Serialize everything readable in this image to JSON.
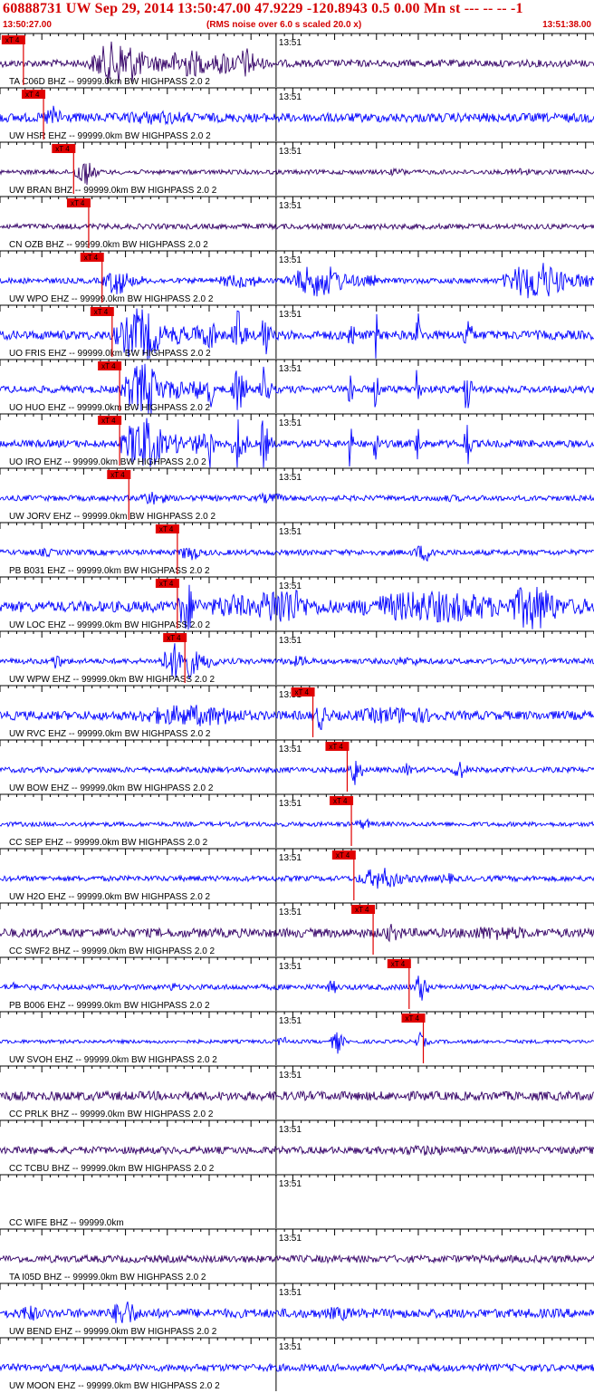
{
  "header": {
    "title": "60888731 UW Sep 29, 2014 13:50:47.00   47.9229 -120.8943  0.5 0.00 Mn st --- -- --  -1",
    "start_time": "13:50:27.00",
    "noise_note": "(RMS noise over 6.0 s scaled 20.0 x)",
    "end_time": "13:51:38.00"
  },
  "chart_data": {
    "type": "seismogram",
    "time_range": [
      "13:50:27.00",
      "13:51:38.00"
    ],
    "minute_label": "13:51",
    "pick_label": "xT 4",
    "colors": {
      "header": "#d40000",
      "pick": "#e00000",
      "trace_blue": "#0000ff",
      "trace_dark": "#330066",
      "grid": "#000000"
    },
    "traces": [
      {
        "label": "TA C06D BHZ -- 99999.0km BW  HIGHPASS  2.0  2",
        "color": "#330066",
        "pick_s": 2.8,
        "amp": 4,
        "bursts": [
          [
            10.5,
            20.5,
            26
          ],
          [
            25,
            30,
            14
          ],
          [
            28,
            32,
            18
          ],
          [
            19,
            28,
            16
          ]
        ]
      },
      {
        "label": "UW HSR EHZ -- 99999.0km BW  HIGHPASS  2.0  2",
        "color": "#0000ff",
        "pick_s": 5.2,
        "amp": 5,
        "bursts": [
          [
            5,
            9,
            14
          ],
          [
            12,
            30,
            8
          ],
          [
            25,
            60,
            5
          ]
        ]
      },
      {
        "label": "UW BRAN BHZ -- 99999.0km BW  HIGHPASS  2.0  2",
        "color": "#330066",
        "pick_s": 8.8,
        "amp": 2.5,
        "bursts": [
          [
            8.8,
            12,
            16
          ],
          [
            45,
            52,
            4
          ],
          [
            60,
            66,
            5
          ]
        ]
      },
      {
        "label": "CN OZB BHZ -- 99999.0km BW  HIGHPASS  2.0  2",
        "color": "#330066",
        "pick_s": 10.6,
        "amp": 3,
        "bursts": []
      },
      {
        "label": "UW WPO EHZ -- 99999.0km BW  HIGHPASS  2.0  2",
        "color": "#0000ff",
        "pick_s": 12.2,
        "amp": 3,
        "bursts": [
          [
            12.2,
            17,
            16
          ],
          [
            25,
            35,
            8
          ],
          [
            34,
            45,
            18
          ],
          [
            60,
            71,
            22
          ]
        ]
      },
      {
        "label": "UO FRIS EHZ -- 99999.0km BW  HIGHPASS  2.0  2",
        "color": "#0000ff",
        "pick_s": 13.4,
        "amp": 5,
        "bursts": [
          [
            13.6,
            22,
            30
          ],
          [
            22,
            28,
            12
          ],
          [
            24.8,
            26,
            30
          ],
          [
            27.7,
            29.6,
            30
          ],
          [
            31,
            32.5,
            30
          ],
          [
            41.6,
            42.4,
            30
          ],
          [
            44.6,
            45.4,
            30
          ],
          [
            49.6,
            50.4,
            30
          ],
          [
            55.4,
            56.6,
            30
          ]
        ]
      },
      {
        "label": "UO HUO EHZ -- 99999.0km BW  HIGHPASS  2.0  2",
        "color": "#0000ff",
        "pick_s": 14.3,
        "amp": 4,
        "bursts": [
          [
            14.3,
            22,
            30
          ],
          [
            22,
            27,
            12
          ],
          [
            24.8,
            25.6,
            30
          ],
          [
            27.7,
            29.6,
            30
          ],
          [
            31,
            32.5,
            30
          ],
          [
            41.6,
            42.4,
            30
          ],
          [
            44.6,
            45.4,
            30
          ],
          [
            49.6,
            50.4,
            30
          ],
          [
            55.4,
            56.6,
            30
          ]
        ]
      },
      {
        "label": "UO IRO EHZ -- 99999.0km BW  HIGHPASS  2.0  2",
        "color": "#0000ff",
        "pick_s": 14.3,
        "amp": 4,
        "bursts": [
          [
            14.3,
            22,
            30
          ],
          [
            22,
            27,
            12
          ],
          [
            24.8,
            25.6,
            30
          ],
          [
            27.7,
            29.6,
            30
          ],
          [
            31,
            32.5,
            30
          ],
          [
            41.6,
            42.4,
            30
          ],
          [
            44.6,
            45.4,
            30
          ],
          [
            49.6,
            50.4,
            30
          ],
          [
            55.4,
            56.6,
            30
          ]
        ]
      },
      {
        "label": "UW JORV EHZ -- 99999.0km BW  HIGHPASS  2.0  2",
        "color": "#0000ff",
        "pick_s": 15.4,
        "amp": 3,
        "bursts": [
          [
            16,
            22,
            8
          ],
          [
            30,
            36,
            6
          ],
          [
            50,
            60,
            4
          ]
        ]
      },
      {
        "label": "PB B031 EHZ -- 99999.0km BW  HIGHPASS  2.0  2",
        "color": "#0000ff",
        "pick_s": 21.2,
        "amp": 3,
        "bursts": [
          [
            21.3,
            25,
            10
          ],
          [
            49,
            54,
            10
          ],
          [
            4,
            8,
            5
          ]
        ]
      },
      {
        "label": "UW LOC EHZ -- 99999.0km BW  HIGHPASS  2.0  2",
        "color": "#0000ff",
        "pick_s": 21.2,
        "amp": 6,
        "bursts": [
          [
            21.2,
            24,
            30
          ],
          [
            24,
            34,
            14
          ],
          [
            30,
            40,
            24
          ],
          [
            40,
            71,
            18
          ],
          [
            60,
            70,
            26
          ]
        ]
      },
      {
        "label": "UW WPW EHZ -- 99999.0km BW  HIGHPASS  2.0  2",
        "color": "#0000ff",
        "pick_s": 22.1,
        "amp": 3,
        "bursts": [
          [
            19,
            26,
            22
          ],
          [
            6,
            8,
            10
          ],
          [
            33,
            40,
            6
          ],
          [
            45,
            55,
            5
          ]
        ]
      },
      {
        "label": "UW RVC EHZ -- 99999.0km BW  HIGHPASS  2.0  2",
        "color": "#0000ff",
        "pick_s": 37.4,
        "amp": 5,
        "bursts": [
          [
            14,
            38,
            12
          ],
          [
            37.4,
            40,
            16
          ],
          [
            40,
            60,
            10
          ]
        ]
      },
      {
        "label": "UW BOW EHZ -- 99999.0km BW  HIGHPASS  2.0  2",
        "color": "#0000ff",
        "pick_s": 41.5,
        "amp": 3,
        "bursts": [
          [
            41.5,
            43.5,
            20
          ],
          [
            48,
            50,
            8
          ],
          [
            54,
            56,
            14
          ]
        ]
      },
      {
        "label": "CC SEP EHZ -- 99999.0km BW  HIGHPASS  2.0  2",
        "color": "#0000ff",
        "pick_s": 42.0,
        "amp": 2.5,
        "bursts": [
          [
            42,
            46,
            6
          ]
        ]
      },
      {
        "label": "UW H2O EHZ -- 99999.0km BW  HIGHPASS  2.0  2",
        "color": "#0000ff",
        "pick_s": 42.3,
        "amp": 3,
        "bursts": [
          [
            42.3,
            51,
            12
          ],
          [
            52,
            56,
            6
          ]
        ]
      },
      {
        "label": "CC SWF2 BHZ -- 99999.0km BW  HIGHPASS  2.0  2",
        "color": "#330066",
        "pick_s": 44.6,
        "amp": 5,
        "bursts": [
          [
            45,
            50,
            10
          ],
          [
            52,
            71,
            8
          ]
        ]
      },
      {
        "label": "PB B006 EHZ -- 99999.0km BW  HIGHPASS  2.0  2",
        "color": "#0000ff",
        "pick_s": 48.9,
        "amp": 3,
        "bursts": [
          [
            49.5,
            51.5,
            18
          ],
          [
            39,
            41,
            8
          ],
          [
            20,
            22,
            6
          ],
          [
            1,
            3,
            6
          ]
        ]
      },
      {
        "label": "UW SVOH EHZ -- 99999.0km BW  HIGHPASS  2.0  2",
        "color": "#0000ff",
        "pick_s": 50.6,
        "amp": 2,
        "bursts": [
          [
            39.5,
            41.5,
            14
          ],
          [
            49.5,
            51.5,
            10
          ],
          [
            33,
            35,
            6
          ]
        ]
      },
      {
        "label": "CC PRLK BHZ -- 99999.0km BW  HIGHPASS  2.0  2",
        "color": "#330066",
        "pick_s": null,
        "amp": 5,
        "bursts": []
      },
      {
        "label": "CC TCBU BHZ -- 99999.0km BW  HIGHPASS  2.0  2",
        "color": "#330066",
        "pick_s": null,
        "amp": 4,
        "bursts": [
          [
            45,
            60,
            6
          ]
        ]
      },
      {
        "label": "CC WIFE BHZ -- 99999.0km",
        "color": "#330066",
        "pick_s": null,
        "amp": 0,
        "bursts": []
      },
      {
        "label": "TA I05D BHZ -- 99999.0km BW  HIGHPASS  2.0  2",
        "color": "#330066",
        "pick_s": null,
        "amp": 4,
        "bursts": []
      },
      {
        "label": "UW BEND EHZ -- 99999.0km BW  HIGHPASS  2.0  2",
        "color": "#0000ff",
        "pick_s": null,
        "amp": 5,
        "bursts": [
          [
            13,
            18,
            16
          ],
          [
            38,
            45,
            8
          ],
          [
            2,
            6,
            10
          ]
        ]
      },
      {
        "label": "UW MOON EHZ -- 99999.0km BW  HIGHPASS  2.0  2",
        "color": "#0000ff",
        "pick_s": null,
        "amp": 4,
        "bursts": []
      }
    ]
  }
}
